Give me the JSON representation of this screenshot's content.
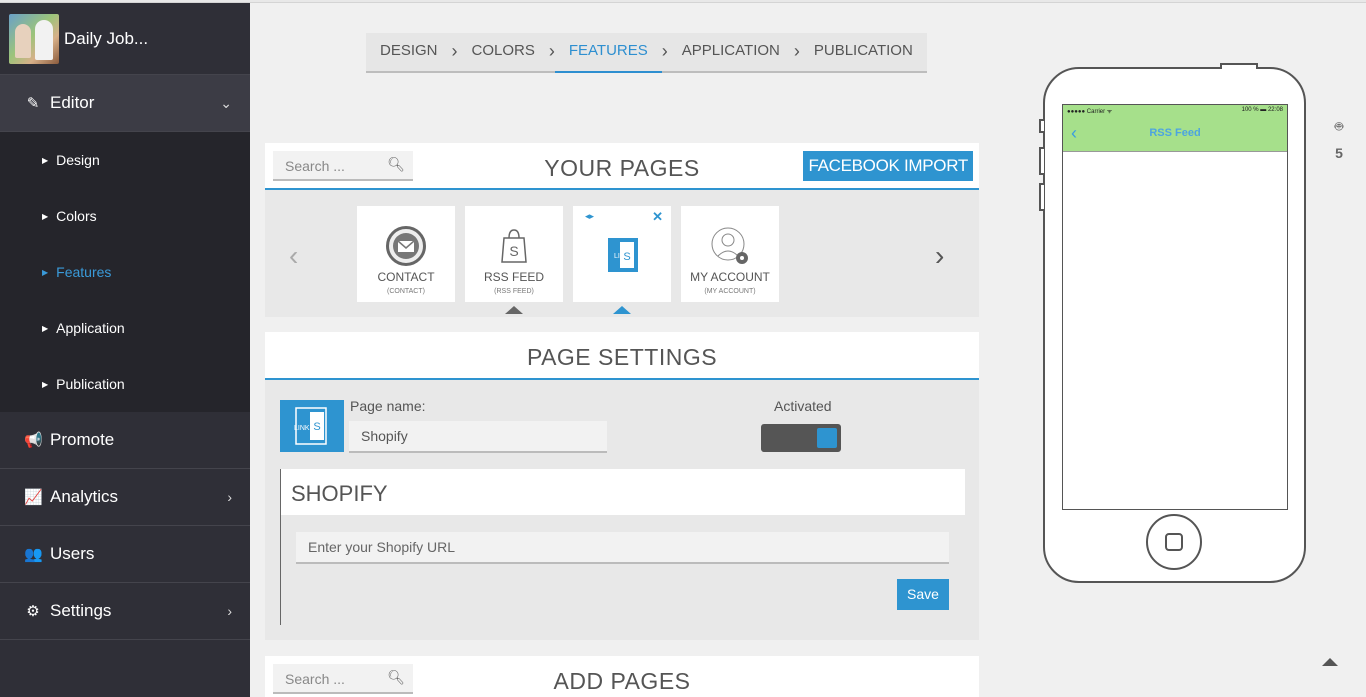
{
  "sidebar": {
    "app_name": "Daily Job...",
    "editor_label": "Editor",
    "sub_items": [
      {
        "label": "Design"
      },
      {
        "label": "Colors"
      },
      {
        "label": "Features"
      },
      {
        "label": "Application"
      },
      {
        "label": "Publication"
      }
    ],
    "promote_label": "Promote",
    "analytics_label": "Analytics",
    "users_label": "Users",
    "settings_label": "Settings"
  },
  "wizard": {
    "steps": [
      "DESIGN",
      "COLORS",
      "FEATURES",
      "APPLICATION",
      "PUBLICATION"
    ],
    "active": "FEATURES"
  },
  "your_pages": {
    "search_placeholder": "Search ...",
    "title": "YOUR PAGES",
    "facebook_import": "FACEBOOK IMPORT",
    "cards": [
      {
        "label": "CONTACT",
        "sub": "(CONTACT)",
        "icon": "envelope-icon"
      },
      {
        "label": "RSS FEED",
        "sub": "(RSS FEED)",
        "icon": "shopping-bag-icon"
      },
      {
        "label": "",
        "sub": "",
        "icon": "link-shopify-icon"
      },
      {
        "label": "MY ACCOUNT",
        "sub": "(MY ACCOUNT)",
        "icon": "user-settings-icon"
      }
    ]
  },
  "page_settings": {
    "title": "PAGE SETTINGS",
    "page_name_label": "Page name:",
    "page_name_value": "Shopify",
    "activated_label": "Activated",
    "activated": true,
    "section_title": "SHOPIFY",
    "url_placeholder": "Enter your Shopify URL",
    "save_label": "Save"
  },
  "add_pages": {
    "search_placeholder": "Search ...",
    "title": "ADD PAGES"
  },
  "phone": {
    "carrier": "●●●●● Carrier ᯤ",
    "status_right": "100 % ▬ 22:08",
    "screen_title": "RSS Feed"
  },
  "colors": {
    "accent": "#2e94d0",
    "sidebar_bg": "#2f2f37",
    "phone_header": "#a6e08b"
  }
}
